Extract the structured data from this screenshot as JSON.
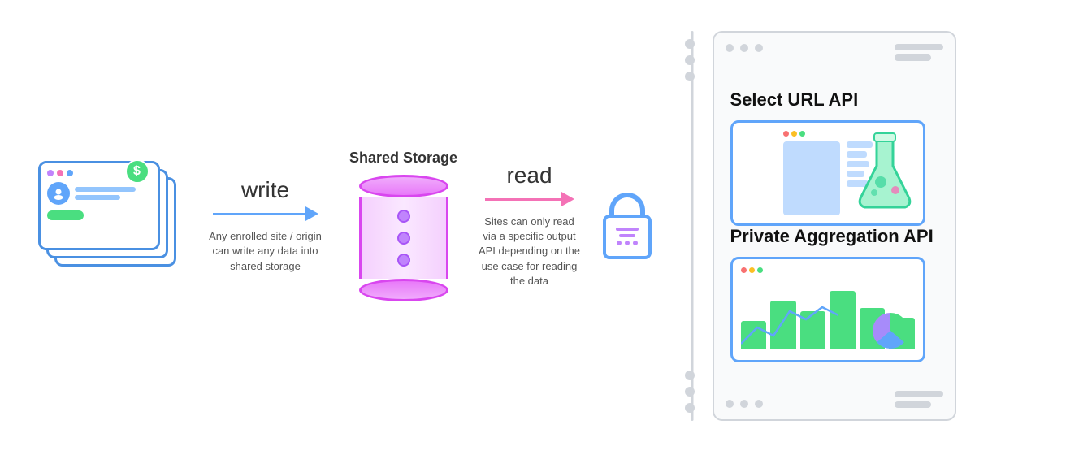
{
  "diagram": {
    "write_label": "write",
    "write_desc": "Any enrolled site / origin can write any data into shared storage",
    "storage_label": "Shared Storage",
    "read_label": "read",
    "read_desc": "Sites can only read via a specific output API depending on the use case for reading the data",
    "select_url_title": "Select URL API",
    "private_agg_title": "Private Aggregation API"
  },
  "colors": {
    "blue": "#4a90e2",
    "pink": "#f472b6",
    "purple": "#d946ef",
    "green": "#4ade80",
    "light_blue": "#60a5fa",
    "gray": "#d1d5db"
  }
}
